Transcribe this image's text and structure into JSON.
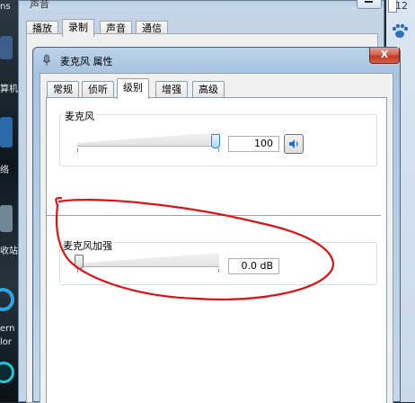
{
  "desktop": {
    "left_texts": [
      "ns",
      "算机",
      "络",
      "收站",
      "ern",
      "lor"
    ],
    "right_clock": "12"
  },
  "background_window": {
    "title": "声音",
    "tabs": [
      "播放",
      "录制",
      "声音",
      "通信"
    ],
    "active_tab": "录制"
  },
  "properties_window": {
    "title": "麦克风 属性",
    "close_label": "X",
    "tabs": [
      "常规",
      "侦听",
      "级别",
      "增强",
      "高级"
    ],
    "active_tab": "级别",
    "microphone": {
      "label": "麦克风",
      "value": "100",
      "level_fraction": 1.0
    },
    "boost": {
      "label": "麦克风加强",
      "value": "0.0 dB",
      "level_fraction": 0.0
    }
  },
  "colors": {
    "annotation": "#e01010",
    "close_button": "#c0391f",
    "titlebar": "#a9c5e1"
  },
  "icons": [
    "microphone-icon",
    "speaker-icon",
    "close-icon",
    "paw-icon"
  ]
}
